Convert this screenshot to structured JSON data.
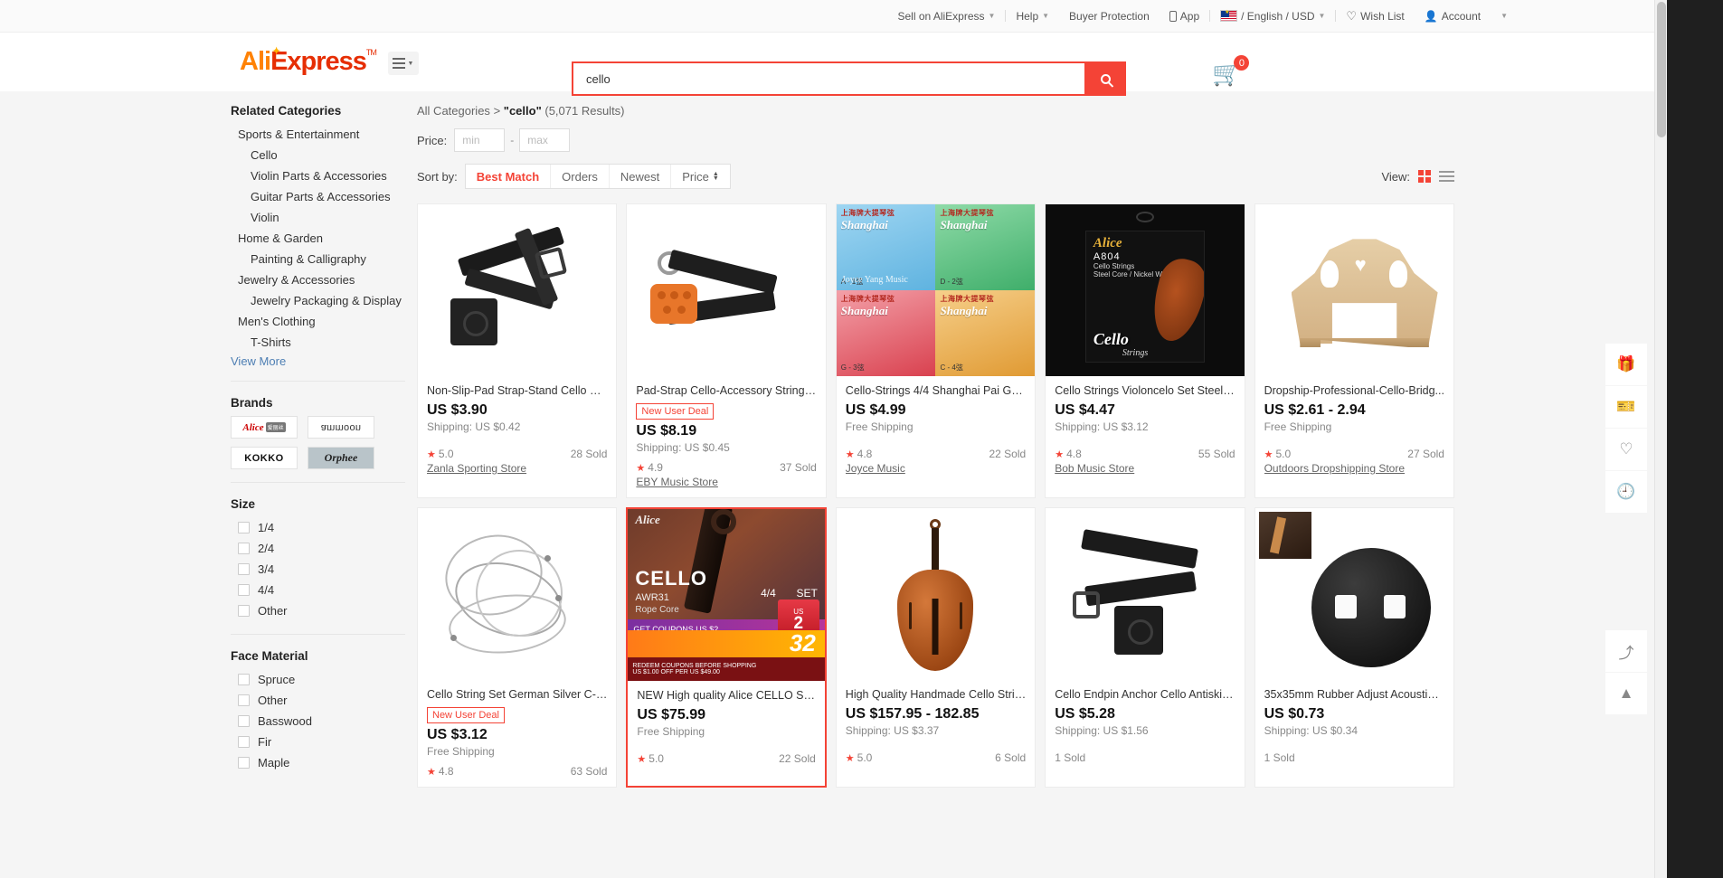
{
  "topbar": {
    "items": [
      {
        "label": "Sell on AliExpress",
        "caret": true,
        "icon": null
      },
      {
        "label": "Help",
        "caret": true,
        "icon": null
      },
      {
        "label": "Buyer Protection",
        "caret": false,
        "icon": null
      },
      {
        "label": "App",
        "caret": false,
        "icon": "phone-icon"
      },
      {
        "label": "/ English / USD",
        "caret": true,
        "icon": "flag-malaysia-icon"
      },
      {
        "label": "Wish List",
        "caret": false,
        "icon": "heart-icon"
      },
      {
        "label": "Account",
        "caret": true,
        "icon": "person-icon"
      }
    ]
  },
  "header": {
    "logo_ali": "Ali",
    "logo_express": "Express",
    "logo_tm": "TM",
    "cart_count": "0"
  },
  "search": {
    "value": "cello",
    "placeholder": "cello"
  },
  "sidebar": {
    "related_categories_title": "Related Categories",
    "categories": [
      {
        "label": "Sports & Entertainment",
        "level": 1
      },
      {
        "label": "Cello",
        "level": 2
      },
      {
        "label": "Violin Parts & Accessories",
        "level": 2
      },
      {
        "label": "Guitar Parts & Accessories",
        "level": 2
      },
      {
        "label": "Violin",
        "level": 2
      },
      {
        "label": "Home & Garden",
        "level": 1
      },
      {
        "label": "Painting & Calligraphy",
        "level": 2
      },
      {
        "label": "Jewelry & Accessories",
        "level": 1
      },
      {
        "label": "Jewelry Packaging & Display",
        "level": 2
      },
      {
        "label": "Men's Clothing",
        "level": 1
      },
      {
        "label": "T-Shirts",
        "level": 2
      }
    ],
    "view_more": "View More",
    "brands_title": "Brands",
    "brands": [
      {
        "name": "Alice",
        "style": "alice"
      },
      {
        "name": "ammoon",
        "style": "ammoon"
      },
      {
        "name": "KOKKO",
        "style": "kokko"
      },
      {
        "name": "Orphee",
        "style": "orphee"
      }
    ],
    "size_title": "Size",
    "sizes": [
      "1/4",
      "2/4",
      "3/4",
      "4/4",
      "Other"
    ],
    "face_material_title": "Face Material",
    "face_materials": [
      "Spruce",
      "Other",
      "Basswood",
      "Fir",
      "Maple"
    ]
  },
  "results_header": {
    "breadcrumb_all": "All Categories",
    "breadcrumb_sep": ">",
    "keyword": "\"cello\"",
    "result_count": "(5,071 Results)",
    "price_label": "Price:",
    "price_min_placeholder": "min",
    "price_max_placeholder": "max",
    "price_min_value": "",
    "price_max_value": "",
    "dash": "-",
    "sort_label": "Sort by:",
    "sort_options": [
      "Best Match",
      "Orders",
      "Newest",
      "Price"
    ],
    "sort_active": "Best Match",
    "view_label": "View:",
    "view_active": "grid"
  },
  "products": [
    {
      "title": "Non-Slip-Pad Strap-Stand Cello Mu...",
      "deal": null,
      "price": "US $3.90",
      "shipping": "Shipping: US $0.42",
      "rating": "5.0",
      "sold": "28 Sold",
      "store": "Zanla Sporting Store",
      "art": "a1",
      "highlight": false
    },
    {
      "title": "Pad-Strap Cello-Accessory Stringe...",
      "deal": "New User Deal",
      "price": "US $8.19",
      "shipping": "Shipping: US $0.45",
      "rating": "4.9",
      "sold": "37 Sold",
      "store": "EBY Music Store",
      "art": "a2",
      "highlight": false
    },
    {
      "title": "Cello-Strings 4/4 Shanghai Pai G-C ...",
      "deal": null,
      "price": "US $4.99",
      "shipping": "Free Shipping",
      "rating": "4.8",
      "sold": "22 Sold",
      "store": "Joyce Music",
      "art": "a3",
      "highlight": false
    },
    {
      "title": "Cello Strings Violoncelo Set Steel-C...",
      "deal": null,
      "price": "US $4.47",
      "shipping": "Shipping: US $3.12",
      "rating": "4.8",
      "sold": "55 Sold",
      "store": "Bob Music Store",
      "art": "a4",
      "highlight": false
    },
    {
      "title": "Dropship-Professional-Cello-Bridg...",
      "deal": null,
      "price": "US $2.61 - 2.94",
      "shipping": "Free Shipping",
      "rating": "5.0",
      "sold": "27 Sold",
      "store": "Outdoors Dropshipping Store",
      "art": "a5",
      "highlight": false
    },
    {
      "title": "Cello String Set German Silver C-G-...",
      "deal": "New User Deal",
      "price": "US $3.12",
      "shipping": "Free Shipping",
      "rating": "4.8",
      "sold": "63 Sold",
      "store": "",
      "art": "a6",
      "highlight": false
    },
    {
      "title": "NEW High quality Alice CELLO Strin...",
      "deal": null,
      "price": "US $75.99",
      "shipping": "Free Shipping",
      "rating": "5.0",
      "sold": "22 Sold",
      "store": "",
      "art": "a7",
      "highlight": true
    },
    {
      "title": "High Quality Handmade Cello Strin...",
      "deal": null,
      "price": "US $157.95 - 182.85",
      "shipping": "Shipping: US $3.37",
      "rating": "5.0",
      "sold": "6 Sold",
      "store": "",
      "art": "a8",
      "highlight": false
    },
    {
      "title": "Cello Endpin Anchor Cello Antiskid...",
      "deal": null,
      "price": "US $5.28",
      "shipping": "Shipping: US $1.56",
      "rating": "",
      "sold": "1 Sold",
      "store": "",
      "art": "a9",
      "highlight": false
    },
    {
      "title": "35x35mm Rubber Adjust Acoustic ...",
      "deal": null,
      "price": "US $0.73",
      "shipping": "Shipping: US $0.34",
      "rating": "",
      "sold": "1 Sold",
      "store": "",
      "art": "a10",
      "highlight": false
    }
  ],
  "rail": {
    "icons": [
      "gift-promo-icon",
      "coupon-icon",
      "wishlist-heart-icon",
      "history-clock-icon"
    ],
    "bottom_icons": [
      "share-icon",
      "scroll-to-top-icon"
    ]
  },
  "colors": {
    "accent": "#f44336",
    "logo_orange": "#ff8205",
    "logo_red": "#e62e04",
    "page_bg": "#f5f5f5",
    "rail_bg": "#1f1f1f"
  }
}
